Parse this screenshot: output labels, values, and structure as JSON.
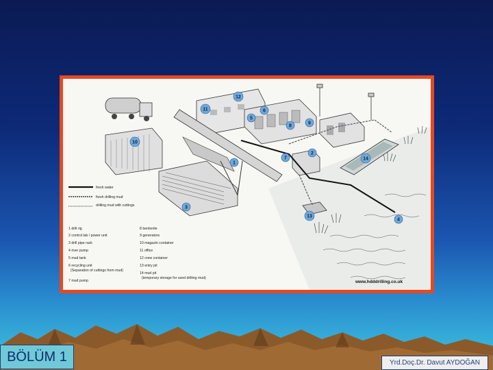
{
  "chapter": {
    "label": "BÖLÜM 1"
  },
  "author": {
    "label": "Yrd.Doç.Dr. Davut AYDOĞAN"
  },
  "diagram": {
    "website": "www.hdddrilling.co.uk",
    "line_legend": [
      {
        "label": "fresh water"
      },
      {
        "label": "fresh drilling mud"
      },
      {
        "label": "drilling mud with cuttings"
      }
    ],
    "components_left": [
      {
        "label": "1  drill rig"
      },
      {
        "label": "2  control lab / power unit"
      },
      {
        "label": "3  drill pipe rack"
      },
      {
        "label": "4  river pump"
      },
      {
        "label": "5  mud tank"
      },
      {
        "label": "6  recycling unit"
      },
      {
        "label": "(Separation of cuttings from mud)"
      },
      {
        "label": "7  mud pump"
      }
    ],
    "components_right": [
      {
        "label": "8  bentonite"
      },
      {
        "label": "9  generators"
      },
      {
        "label": "10  magazin container"
      },
      {
        "label": "11  office"
      },
      {
        "label": "12  crew container"
      },
      {
        "label": "13  entry pit"
      },
      {
        "label": "14  mud pit"
      },
      {
        "label": "(temporary storage for used drilling mud)"
      }
    ],
    "badges": [
      {
        "n": "1"
      },
      {
        "n": "2"
      },
      {
        "n": "3"
      },
      {
        "n": "4"
      },
      {
        "n": "5"
      },
      {
        "n": "6"
      },
      {
        "n": "7"
      },
      {
        "n": "8"
      },
      {
        "n": "9"
      },
      {
        "n": "10"
      },
      {
        "n": "11"
      },
      {
        "n": "12"
      },
      {
        "n": "13"
      },
      {
        "n": "14"
      }
    ]
  },
  "colors": {
    "frame": "#e8481f",
    "background_top": "#0b1a52",
    "background_bottom": "#3fc6e0",
    "badge": "#6fa9dd"
  }
}
